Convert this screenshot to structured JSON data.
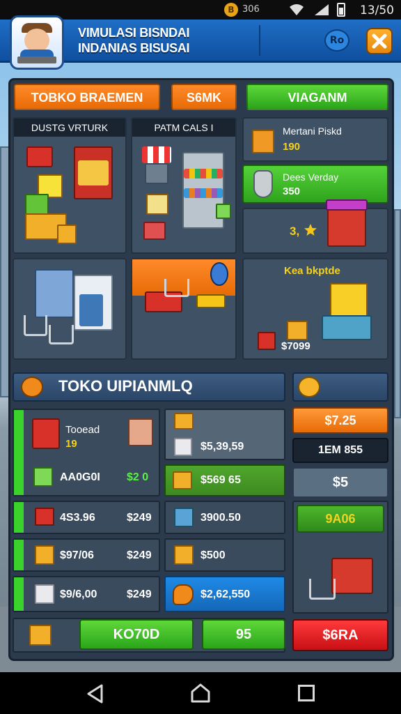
{
  "status_bar": {
    "coin_symbol": "B",
    "coin_value": "306",
    "clock": "13/50"
  },
  "header": {
    "title_line1": "VIMULASI BISNDAI",
    "title_line2": "INDANIAS BISUSAI",
    "badge": "Ro"
  },
  "tabs": {
    "tab1": "TOBKO BRAEMEN",
    "tab2": "S6MK",
    "tab3": "VIAGANM"
  },
  "shop_cards": {
    "card1_label": "DUSTG VRTURK",
    "card2_label": "PATM CALS I"
  },
  "offers": [
    {
      "name": "Mertani Piskd",
      "price": "190"
    },
    {
      "name": "Dees Verday",
      "price": "350"
    }
  ],
  "stall_offer": {
    "price": "3,"
  },
  "package_card": {
    "title": "Kea bkptde",
    "price": "$7099"
  },
  "section": {
    "title": "TOKO UIPIANMLQ"
  },
  "top_item": {
    "name": "Tooead",
    "qty": "19",
    "code": "AA0G0I",
    "price": "$2 0"
  },
  "items": [
    {
      "left": "4S3.96",
      "right": "$249"
    },
    {
      "left": "$97/06",
      "right": "$249"
    },
    {
      "left": "$9/6,00",
      "right": "$249"
    }
  ],
  "mid_items": [
    "$5,39,59",
    "$569 65",
    "3900.50",
    "$500",
    "$2,62,550"
  ],
  "right_column": {
    "price1": "$7.25",
    "label": "1EM 855",
    "value": "$5",
    "value2": "9A06"
  },
  "bottom_bar": {
    "button1": "KO70D",
    "button2": "95",
    "button3": "$6RA"
  },
  "colors": {
    "accent_orange": "#e76b06",
    "accent_green": "#2aa51b",
    "danger_red": "#e3151b",
    "header_blue": "#1f6fc6"
  }
}
